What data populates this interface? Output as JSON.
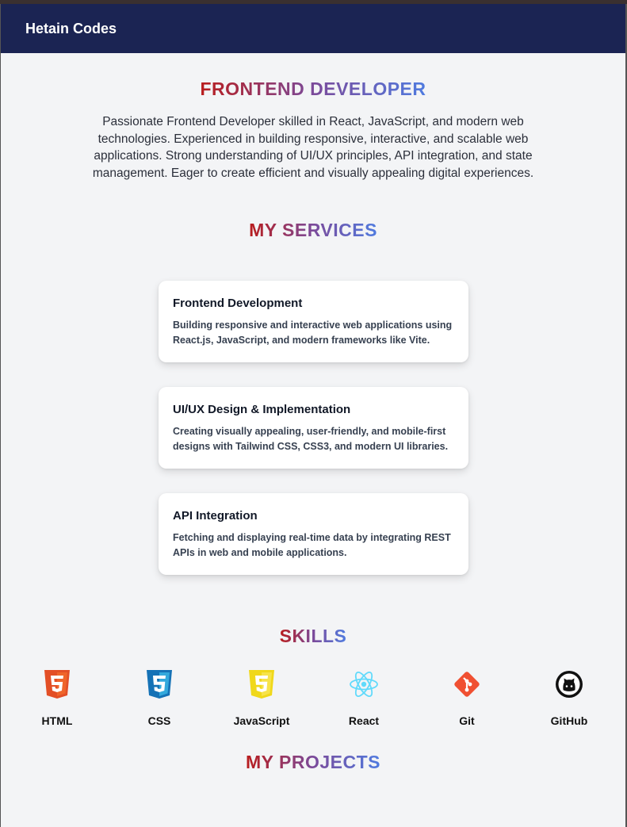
{
  "navbar": {
    "brand": "Hetain Codes"
  },
  "hero": {
    "title": "FRONTEND DEVELOPER",
    "description": "Passionate Frontend Developer skilled in React, JavaScript, and modern web technologies. Experienced in building responsive, interactive, and scalable web applications. Strong understanding of UI/UX principles, API integration, and state management. Eager to create efficient and visually appealing digital experiences."
  },
  "services": {
    "heading": "MY SERVICES",
    "items": [
      {
        "title": "Frontend Development",
        "description": "Building responsive and interactive web applications using React.js, JavaScript, and modern frameworks like Vite."
      },
      {
        "title": "UI/UX Design & Implementation",
        "description": "Creating visually appealing, user-friendly, and mobile-first designs with Tailwind CSS, CSS3, and modern UI libraries."
      },
      {
        "title": "API Integration",
        "description": "Fetching and displaying real-time data by integrating REST APIs in web and mobile applications."
      }
    ]
  },
  "skills": {
    "heading": "SKILLS",
    "items": [
      {
        "label": "HTML",
        "icon": "html5-icon",
        "color": "#e34f26"
      },
      {
        "label": "CSS",
        "icon": "css3-icon",
        "color": "#1572b6"
      },
      {
        "label": "JavaScript",
        "icon": "javascript-icon",
        "color": "#f7df1e"
      },
      {
        "label": "React",
        "icon": "react-icon",
        "color": "#61dafb"
      },
      {
        "label": "Git",
        "icon": "git-icon",
        "color": "#f05032"
      },
      {
        "label": "GitHub",
        "icon": "github-icon",
        "color": "#111111"
      }
    ]
  },
  "projects": {
    "heading": "MY PROJECTS"
  },
  "colors": {
    "navbar": "#1b2453",
    "background": "#f3f4f6",
    "gradient_start": "#b91c1c",
    "gradient_end": "#4f7be0"
  }
}
